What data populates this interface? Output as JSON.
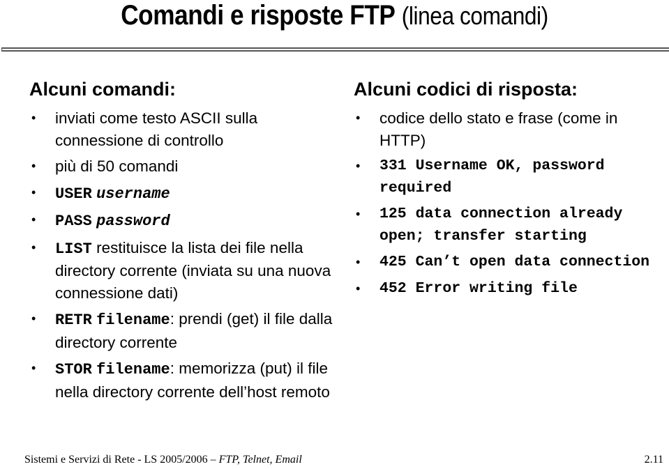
{
  "slide": {
    "title_main": "Comandi e risposte FTP",
    "title_sub": "(linea comandi)"
  },
  "left": {
    "heading": "Alcuni comandi:",
    "items": [
      {
        "text": "inviati come testo ASCII sulla connessione di controllo"
      },
      {
        "text": "più di 50 comandi"
      },
      {
        "cmd": "USER",
        "arg": "username"
      },
      {
        "cmd": "PASS",
        "arg": "password"
      },
      {
        "cmd": "LIST",
        "text": "restituisce la lista dei file nella directory corrente (inviata su una nuova connessione dati)"
      },
      {
        "cmd": "RETR",
        "arg": "filename",
        "text": ": prendi (get) il file dalla directory corrente"
      },
      {
        "cmd": "STOR",
        "arg": "filename",
        "text": ": memorizza (put) il file nella directory corrente dell’host remoto"
      }
    ]
  },
  "right": {
    "heading": "Alcuni codici di risposta:",
    "intro": "codice dello stato e frase (come in HTTP)",
    "codes": [
      "331 Username OK, password required",
      "125 data connection already open; transfer starting",
      "425 Can’t open data connection",
      "452 Error writing file"
    ]
  },
  "footer": {
    "course": "Sistemi e Servizi di Rete - LS 2005/2006 – ",
    "topic": "FTP, Telnet, Email",
    "page": "2.11"
  },
  "bullet": "•"
}
